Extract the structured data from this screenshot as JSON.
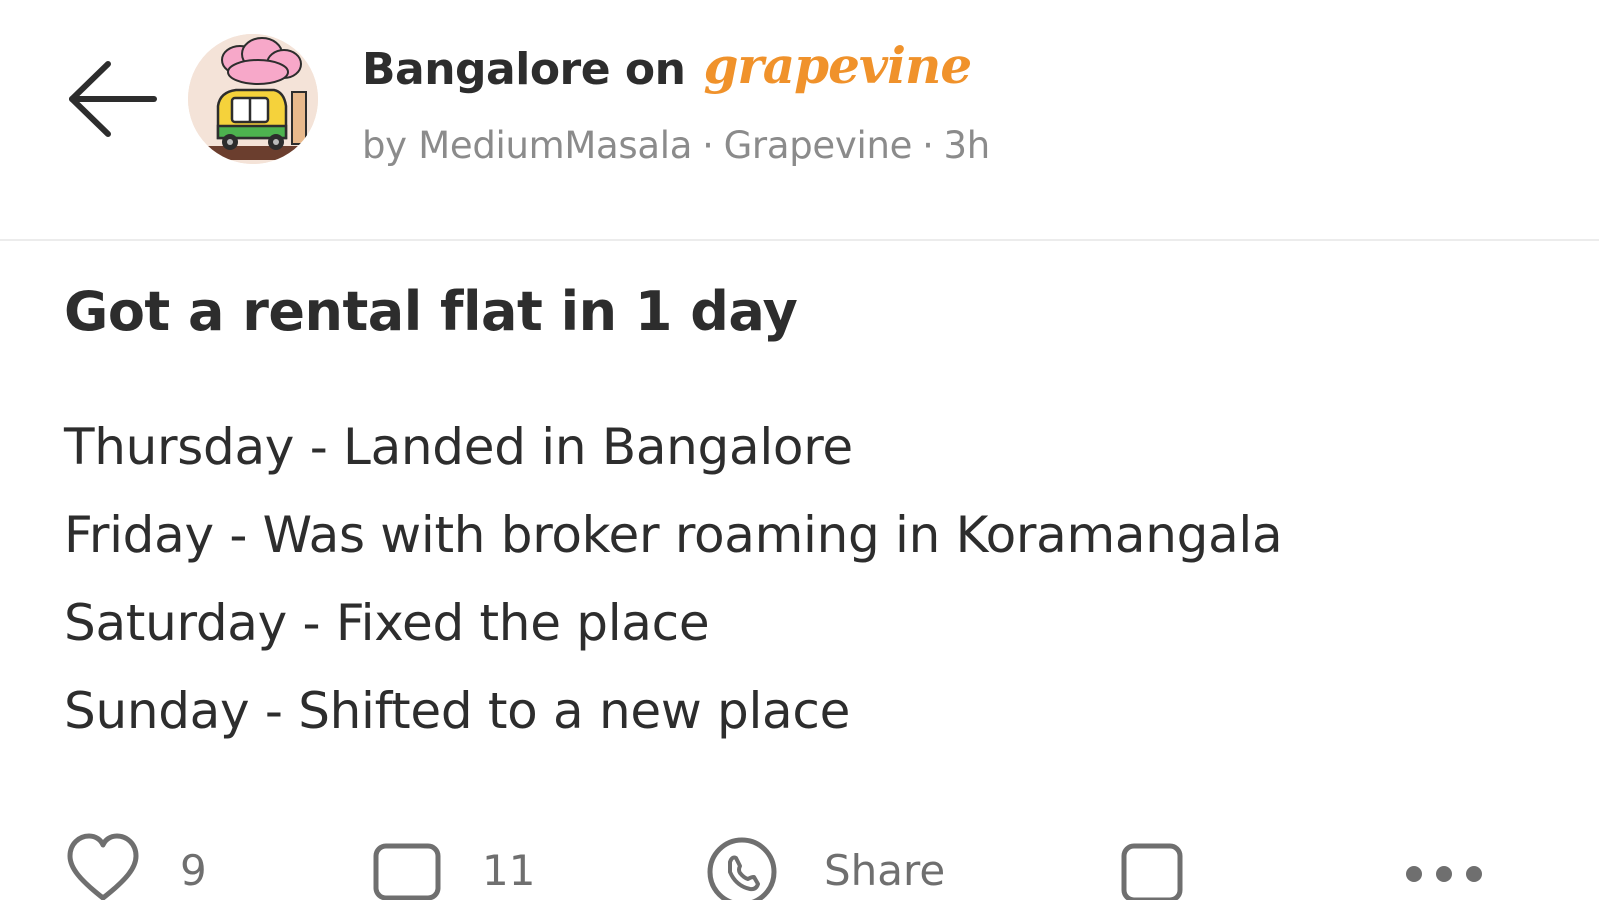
{
  "header": {
    "group_name": "Bangalore on",
    "brand": "grapevine",
    "author": "by MediumMasala",
    "separator": "·",
    "community": "Grapevine",
    "time": "3h"
  },
  "post": {
    "title": "Got a rental flat in 1 day",
    "lines": [
      "Thursday - Landed in Bangalore",
      "Friday - Was with broker roaming in Koramangala",
      "Saturday - Fixed the place",
      "Sunday - Shifted to a new place"
    ]
  },
  "actions": {
    "likes": "9",
    "comments": "11",
    "share_label": "Share"
  },
  "icons": {
    "back": "arrow-left-icon",
    "like": "heart-icon",
    "comment": "comment-icon",
    "share": "whatsapp-icon",
    "bookmark": "bookmark-icon",
    "more": "more-horizontal-icon"
  },
  "colors": {
    "brand": "#f0922b",
    "text": "#2d2d2d",
    "muted": "#8b8b8b",
    "divider": "#ececec"
  }
}
